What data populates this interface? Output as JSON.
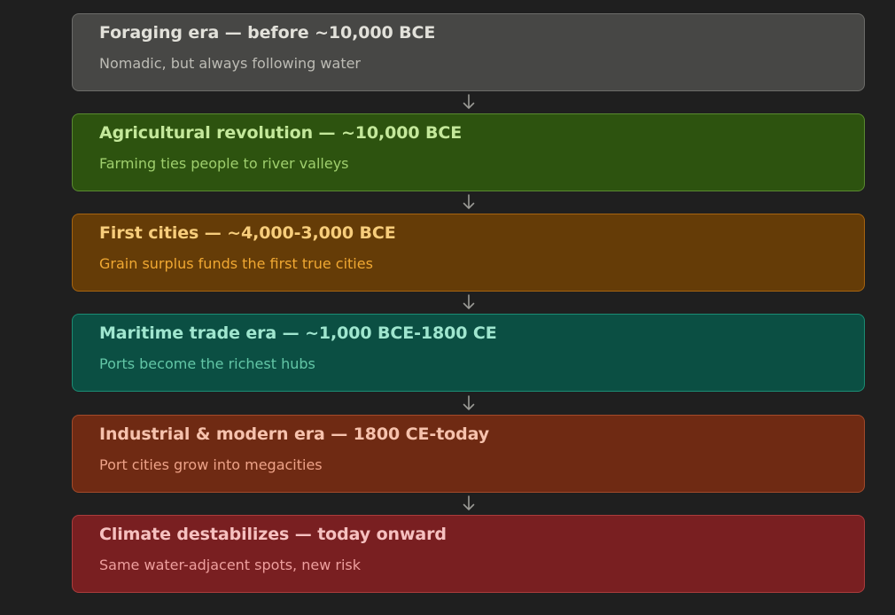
{
  "colors": {
    "background": "#1f1f1f",
    "connector": "#9a9a95",
    "foraging": "#474745",
    "agricultural": "#2d530f",
    "cities": "#653c07",
    "maritime": "#0b4f43",
    "industrial": "#6f2a13",
    "climate": "#791f21"
  },
  "eras": [
    {
      "title": "Foraging era — before ~10,000 BCE",
      "subtitle": "Nomadic, but always following water"
    },
    {
      "title": "Agricultural revolution — ~10,000 BCE",
      "subtitle": "Farming ties people to river valleys"
    },
    {
      "title": "First cities — ~4,000-3,000 BCE",
      "subtitle": "Grain surplus funds the first true cities"
    },
    {
      "title": "Maritime trade era — ~1,000 BCE-1800 CE",
      "subtitle": "Ports become the richest hubs"
    },
    {
      "title": "Industrial & modern era — 1800 CE-today",
      "subtitle": "Port cities grow into megacities"
    },
    {
      "title": "Climate destabilizes — today onward",
      "subtitle": "Same water-adjacent spots, new risk"
    }
  ],
  "connectors": [
    {
      "icon": "arrow-down-icon"
    },
    {
      "icon": "arrow-down-icon"
    },
    {
      "icon": "arrow-down-icon"
    },
    {
      "icon": "arrow-down-icon"
    },
    {
      "icon": "arrow-down-icon"
    }
  ]
}
